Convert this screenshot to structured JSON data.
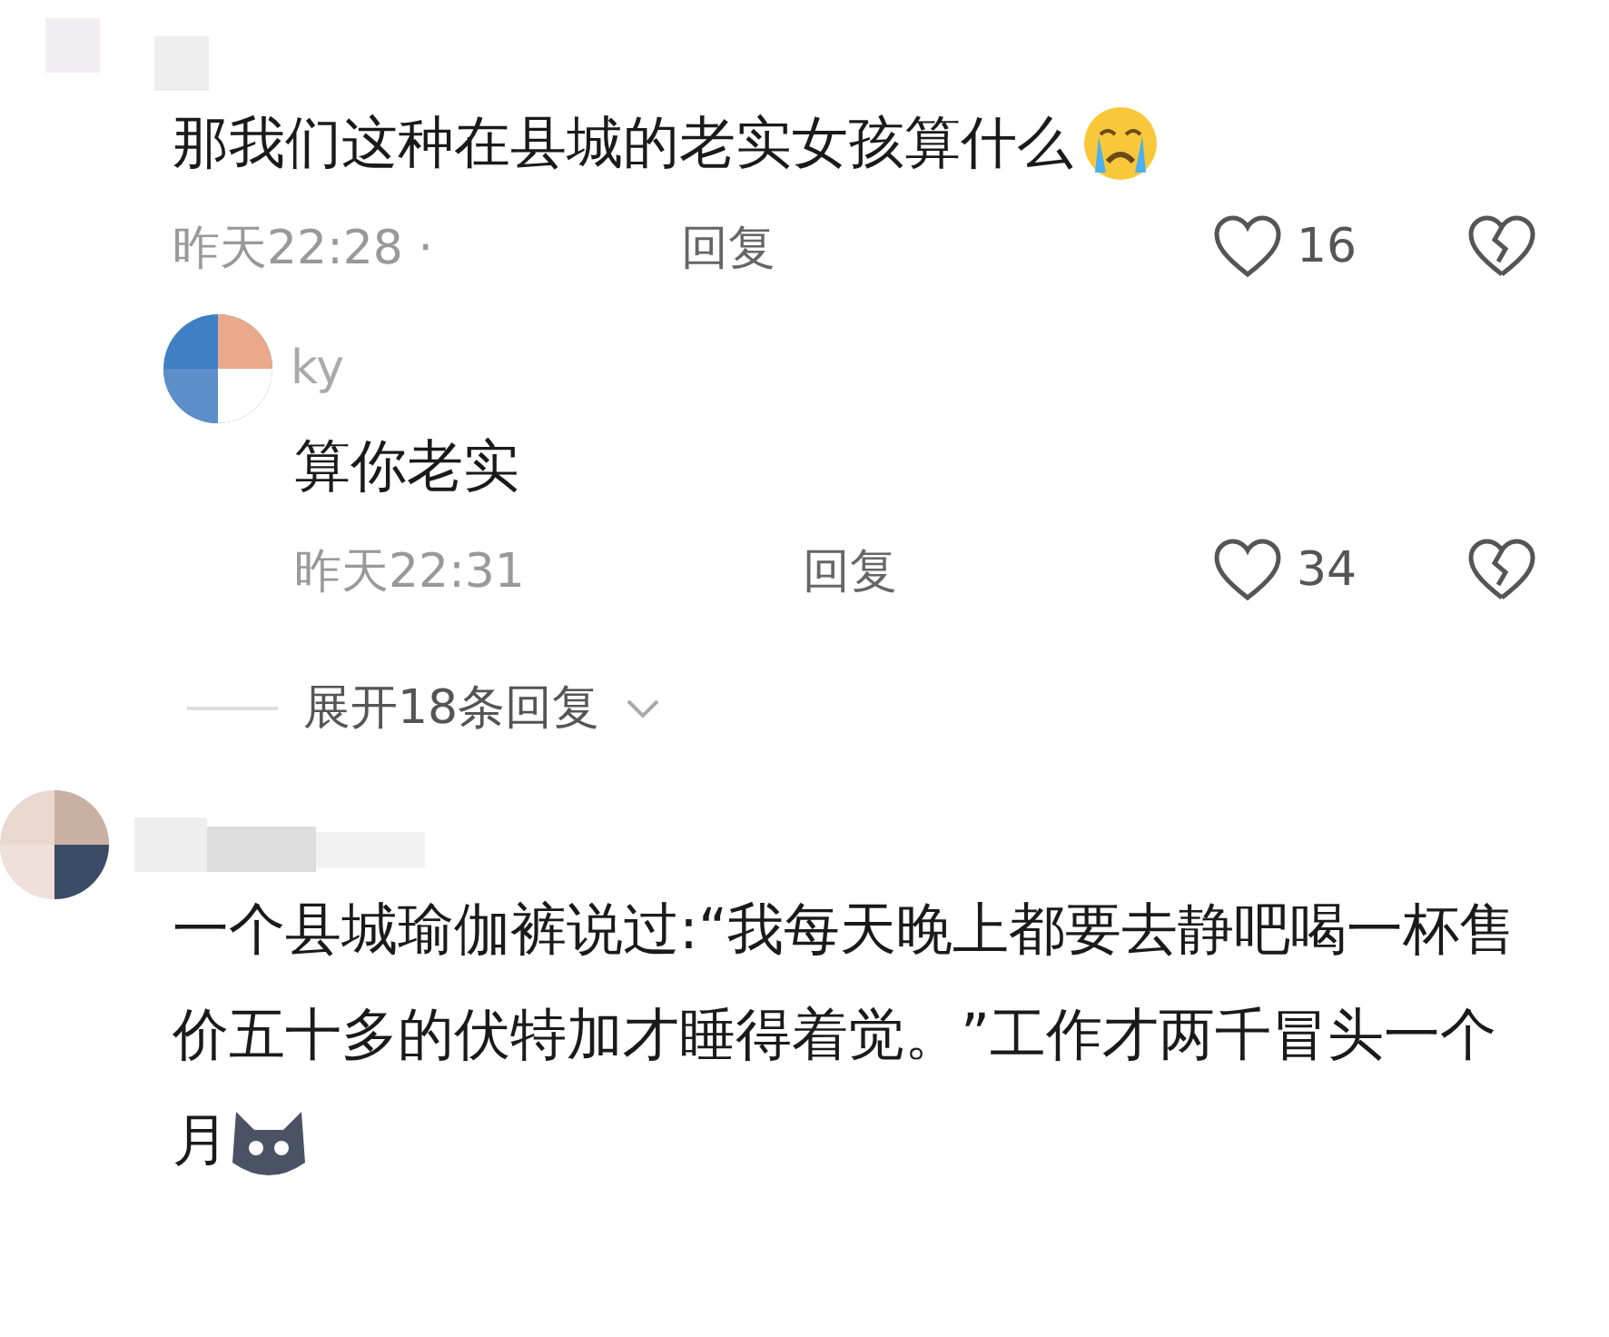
{
  "comments": [
    {
      "text": "那我们这种在县城的老实女孩算什么",
      "time": "昨天22:28 ·",
      "reply": "回复",
      "likes": "16",
      "replies": [
        {
          "name": "ky",
          "text": "算你老实",
          "time": "昨天22:31",
          "reply": "回复",
          "likes": "34"
        }
      ],
      "expand": "展开18条回复"
    },
    {
      "text": "一个县城瑜伽裤说过:“我每天晚上都要去静吧喝一杯售价五十多的伏特加才睡得着觉。”工作才两千冒头一个月"
    }
  ]
}
